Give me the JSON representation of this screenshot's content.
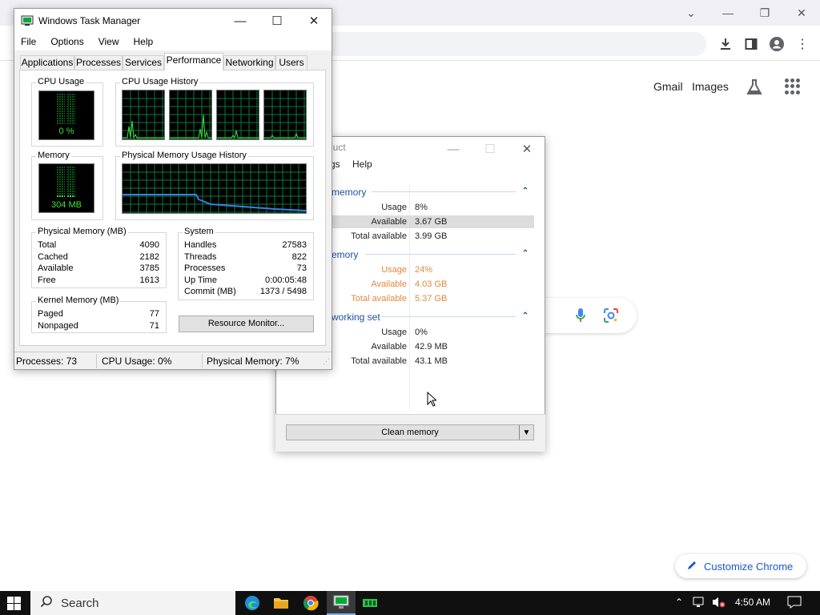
{
  "taskmgr": {
    "title": "Windows Task Manager",
    "menu": [
      "File",
      "Options",
      "View",
      "Help"
    ],
    "tabs": [
      "Applications",
      "Processes",
      "Services",
      "Performance",
      "Networking",
      "Users"
    ],
    "active_tab": "Performance",
    "cpu_usage_label": "CPU Usage",
    "cpu_usage_value": "0 %",
    "cpu_history_label": "CPU Usage History",
    "memory_label": "Memory",
    "memory_value": "304 MB",
    "phys_history_label": "Physical Memory Usage History",
    "physical_memory": {
      "title": "Physical Memory (MB)",
      "rows": [
        {
          "label": "Total",
          "value": "4090"
        },
        {
          "label": "Cached",
          "value": "2182"
        },
        {
          "label": "Available",
          "value": "3785"
        },
        {
          "label": "Free",
          "value": "1613"
        }
      ]
    },
    "system": {
      "title": "System",
      "rows": [
        {
          "label": "Handles",
          "value": "27583"
        },
        {
          "label": "Threads",
          "value": "822"
        },
        {
          "label": "Processes",
          "value": "73"
        },
        {
          "label": "Up Time",
          "value": "0:00:05:48"
        },
        {
          "label": "Commit (MB)",
          "value": "1373 / 5498"
        }
      ]
    },
    "kernel_memory": {
      "title": "Kernel Memory (MB)",
      "rows": [
        {
          "label": "Paged",
          "value": "77"
        },
        {
          "label": "Nonpaged",
          "value": "71"
        }
      ]
    },
    "resource_monitor_button": "Resource Monitor...",
    "status": {
      "processes": "Processes: 73",
      "cpu": "CPU Usage: 0%",
      "memory": "Physical Memory: 7%"
    }
  },
  "cleaner": {
    "title_fragment": "duct",
    "menu": [
      "gs",
      "Help"
    ],
    "sections": [
      {
        "title": "memory",
        "rows": [
          {
            "label": "Usage",
            "value": "8%"
          },
          {
            "label": "Available",
            "value": "3.67 GB"
          },
          {
            "label": "Total available",
            "value": "3.99 GB"
          }
        ]
      },
      {
        "title": "emory",
        "rows": [
          {
            "label": "Usage",
            "value": "24%"
          },
          {
            "label": "Available",
            "value": "4.03 GB"
          },
          {
            "label": "Total available",
            "value": "5.37 GB"
          }
        ]
      },
      {
        "title": "working set",
        "rows": [
          {
            "label": "Usage",
            "value": "0%"
          },
          {
            "label": "Available",
            "value": "42.9 MB"
          },
          {
            "label": "Total available",
            "value": "43.1 MB"
          }
        ]
      }
    ],
    "clean_button": "Clean memory",
    "warning_color": "#e0883c"
  },
  "chrome": {
    "links": [
      "Gmail",
      "Images"
    ],
    "customize_button": "Customize Chrome"
  },
  "taskbar": {
    "search_label": "Search",
    "time": "4:50 AM"
  },
  "colors": {
    "graph_green": "#3fe33f",
    "grid_green": "#0a7a3a",
    "memory_line": "#3a7fe6",
    "link_blue": "#1a57c9"
  }
}
